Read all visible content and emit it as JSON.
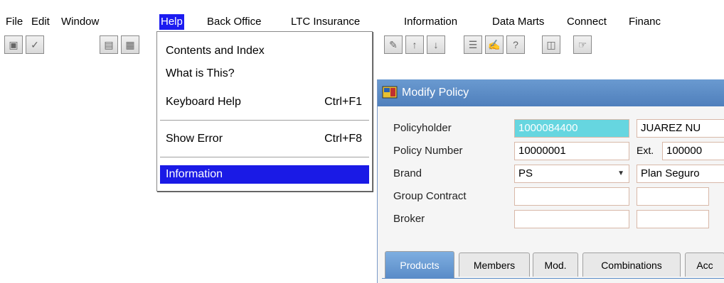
{
  "menubar": {
    "items": [
      {
        "label": "File"
      },
      {
        "label": "Edit"
      },
      {
        "label": "Window"
      },
      {
        "label": "Help"
      },
      {
        "label": "Back Office"
      },
      {
        "label": "LTC Insurance"
      },
      {
        "label": "Information"
      },
      {
        "label": "Data Marts"
      },
      {
        "label": "Connect"
      },
      {
        "label": "Financ"
      }
    ],
    "active": "Help"
  },
  "toolbar": {
    "icons": [
      "save-icon",
      "check-icon",
      "print-icon",
      "window-icon",
      "clear-icon",
      "up-arrow-icon",
      "down-arrow-icon",
      "list-icon",
      "edit-icon",
      "help-icon",
      "document-icon",
      "hand-icon"
    ]
  },
  "help_menu": {
    "items": [
      {
        "label": "Contents and Index",
        "shortcut": ""
      },
      {
        "label": "What is This?",
        "shortcut": ""
      },
      {
        "label": "Keyboard Help",
        "shortcut": "Ctrl+F1"
      },
      {
        "label": "Show Error",
        "shortcut": "Ctrl+F8"
      },
      {
        "label": "Information",
        "shortcut": ""
      }
    ],
    "selected": "Information"
  },
  "window": {
    "title": "Modify Policy",
    "form": {
      "policyholder_label": "Policyholder",
      "policyholder_id": "1000084400",
      "policyholder_name": "JUAREZ NU",
      "policy_number_label": "Policy Number",
      "policy_number": "10000001",
      "ext_label": "Ext.",
      "ext_value": "100000",
      "brand_label": "Brand",
      "brand_code": "PS",
      "brand_name": "Plan Seguro",
      "group_contract_label": "Group Contract",
      "broker_label": "Broker"
    },
    "tabs": [
      {
        "label": "Products"
      },
      {
        "label": "Members"
      },
      {
        "label": "Mod."
      },
      {
        "label": "Combinations"
      },
      {
        "label": "Acc"
      }
    ],
    "active_tab": "Products"
  },
  "colors": {
    "menu_highlight": "#1c1cf0",
    "titlebar": "#5a8cc8",
    "highlight_field": "#66d6e0"
  }
}
